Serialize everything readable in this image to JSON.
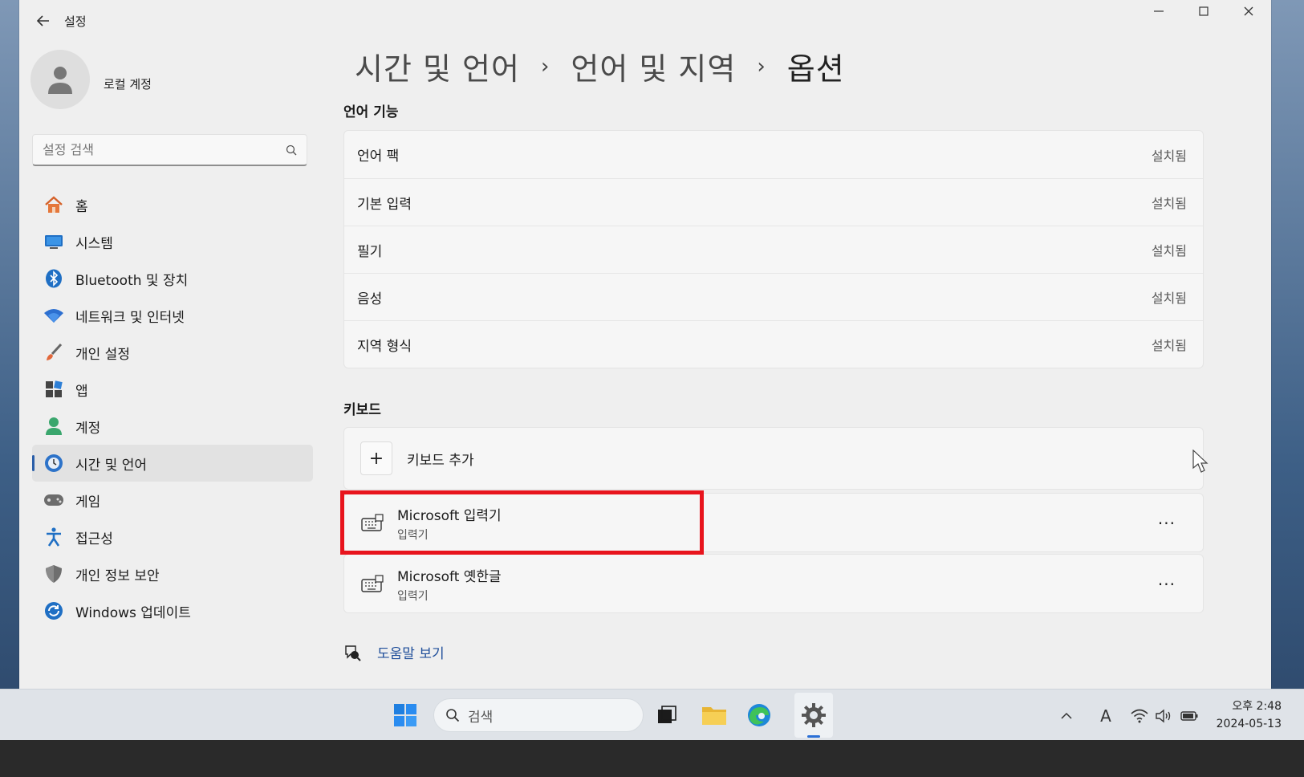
{
  "window": {
    "title": "설정"
  },
  "profile": {
    "name": "로컬 계정"
  },
  "search": {
    "placeholder": "설정 검색"
  },
  "sidebar": {
    "items": [
      {
        "label": "홈",
        "icon": "home-icon"
      },
      {
        "label": "시스템",
        "icon": "system-icon"
      },
      {
        "label": "Bluetooth 및 장치",
        "icon": "bluetooth-icon"
      },
      {
        "label": "네트워크 및 인터넷",
        "icon": "wifi-icon"
      },
      {
        "label": "개인 설정",
        "icon": "brush-icon"
      },
      {
        "label": "앱",
        "icon": "apps-icon"
      },
      {
        "label": "계정",
        "icon": "account-icon"
      },
      {
        "label": "시간 및 언어",
        "icon": "clock-globe-icon",
        "active": true
      },
      {
        "label": "게임",
        "icon": "gamepad-icon"
      },
      {
        "label": "접근성",
        "icon": "accessibility-icon"
      },
      {
        "label": "개인 정보 보안",
        "icon": "shield-icon"
      },
      {
        "label": "Windows 업데이트",
        "icon": "update-icon"
      }
    ]
  },
  "breadcrumb": {
    "level1": "시간 및 언어",
    "level2": "언어 및 지역",
    "current": "옵션",
    "separator": "›"
  },
  "language_features": {
    "title": "언어 기능",
    "rows": [
      {
        "label": "언어 팩",
        "status": "설치됨"
      },
      {
        "label": "기본 입력",
        "status": "설치됨"
      },
      {
        "label": "필기",
        "status": "설치됨"
      },
      {
        "label": "음성",
        "status": "설치됨"
      },
      {
        "label": "지역 형식",
        "status": "설치됨"
      }
    ]
  },
  "keyboard": {
    "title": "키보드",
    "add_label": "키보드 추가",
    "plus": "+",
    "items": [
      {
        "name": "Microsoft 입력기",
        "type": "입력기",
        "more": "···"
      },
      {
        "name": "Microsoft 옛한글",
        "type": "입력기",
        "more": "···"
      }
    ]
  },
  "help": {
    "label": "도움말 보기"
  },
  "taskbar": {
    "search_label": "검색",
    "ime_indicator": "A",
    "clock_time": "오후 2:48",
    "clock_date": "2024-05-13"
  },
  "colors": {
    "accent": "#2a5ea8",
    "highlight": "#e8141d",
    "link": "#1f4e9a"
  }
}
